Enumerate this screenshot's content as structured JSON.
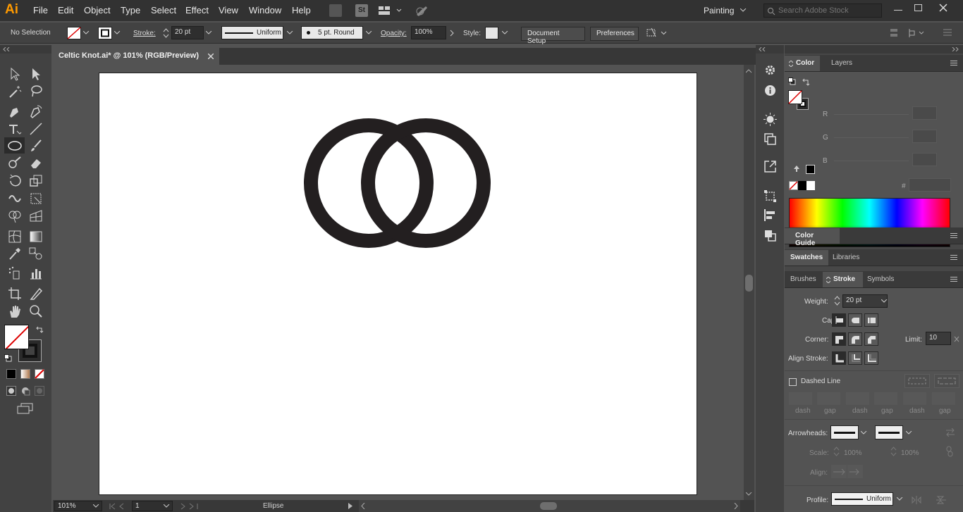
{
  "app": {
    "logo": "Ai"
  },
  "menu": [
    "File",
    "Edit",
    "Object",
    "Type",
    "Select",
    "Effect",
    "View",
    "Window",
    "Help"
  ],
  "menu_icons": [
    "bridge-icon",
    "stock-icon",
    "arrange-docs-icon",
    "gpu-rocket-icon"
  ],
  "workspace": "Painting",
  "search": {
    "placeholder": "Search Adobe Stock"
  },
  "control": {
    "selection": "No Selection",
    "stroke_label": "Stroke:",
    "stroke_value": "20 pt",
    "profile": "Uniform",
    "brush": "5 pt. Round",
    "opacity_label": "Opacity:",
    "opacity_value": "100%",
    "style_label": "Style:",
    "doc_setup": "Document Setup",
    "preferences": "Preferences"
  },
  "document": {
    "tab_title": "Celtic Knot.ai* @ 101% (RGB/Preview)"
  },
  "status": {
    "zoom": "101%",
    "artboard": "1",
    "tool": "Ellipse"
  },
  "color_panel": {
    "tabs": [
      "Color",
      "Layers"
    ],
    "channels": [
      "R",
      "G",
      "B"
    ],
    "hex_label": "#"
  },
  "color_guide": {
    "title": "Color Guide"
  },
  "swatches": {
    "tabs": [
      "Swatches",
      "Libraries"
    ]
  },
  "stroke_panel": {
    "tabs": [
      "Brushes",
      "Stroke",
      "Symbols"
    ],
    "weight_label": "Weight:",
    "weight_value": "20 pt",
    "cap_label": "Cap:",
    "corner_label": "Corner:",
    "limit_label": "Limit:",
    "limit_value": "10",
    "align_label": "Align Stroke:",
    "dashed_label": "Dashed Line",
    "dash_fields": [
      "dash",
      "gap",
      "dash",
      "gap",
      "dash",
      "gap"
    ],
    "arrowheads_label": "Arrowheads:",
    "scale_label": "Scale:",
    "scale_values": [
      "100%",
      "100%"
    ],
    "align_arrows_label": "Align:",
    "profile_label": "Profile:",
    "profile_value": "Uniform"
  },
  "colors": {
    "fill": "#ffffff",
    "stroke": "#231f20",
    "accent": "#ff9a00"
  }
}
